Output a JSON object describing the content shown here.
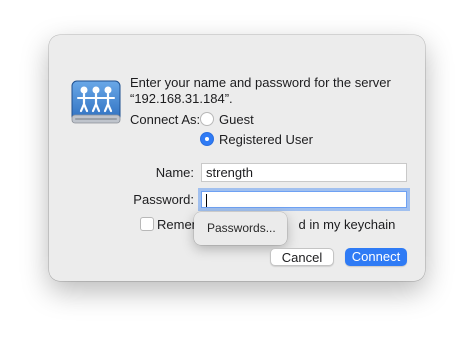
{
  "dialog": {
    "message_line1": "Enter your name and password for the server",
    "message_line2": "“192.168.31.184”.",
    "connect_as_label": "Connect As:",
    "options": [
      {
        "label": "Guest",
        "selected": false
      },
      {
        "label": "Registered User",
        "selected": true
      }
    ],
    "name_label": "Name:",
    "name_value": "strength",
    "password_label": "Password:",
    "password_value": "",
    "remember_label_start": "Remem",
    "remember_label_end": "d in my keychain",
    "remember_checked": false,
    "popover_item": "Passwords...",
    "cancel_label": "Cancel",
    "connect_label": "Connect"
  },
  "colors": {
    "accent": "#2f7bf5",
    "dialog_bg": "#ececec"
  },
  "icons": {
    "server": "shared-server-icon"
  }
}
